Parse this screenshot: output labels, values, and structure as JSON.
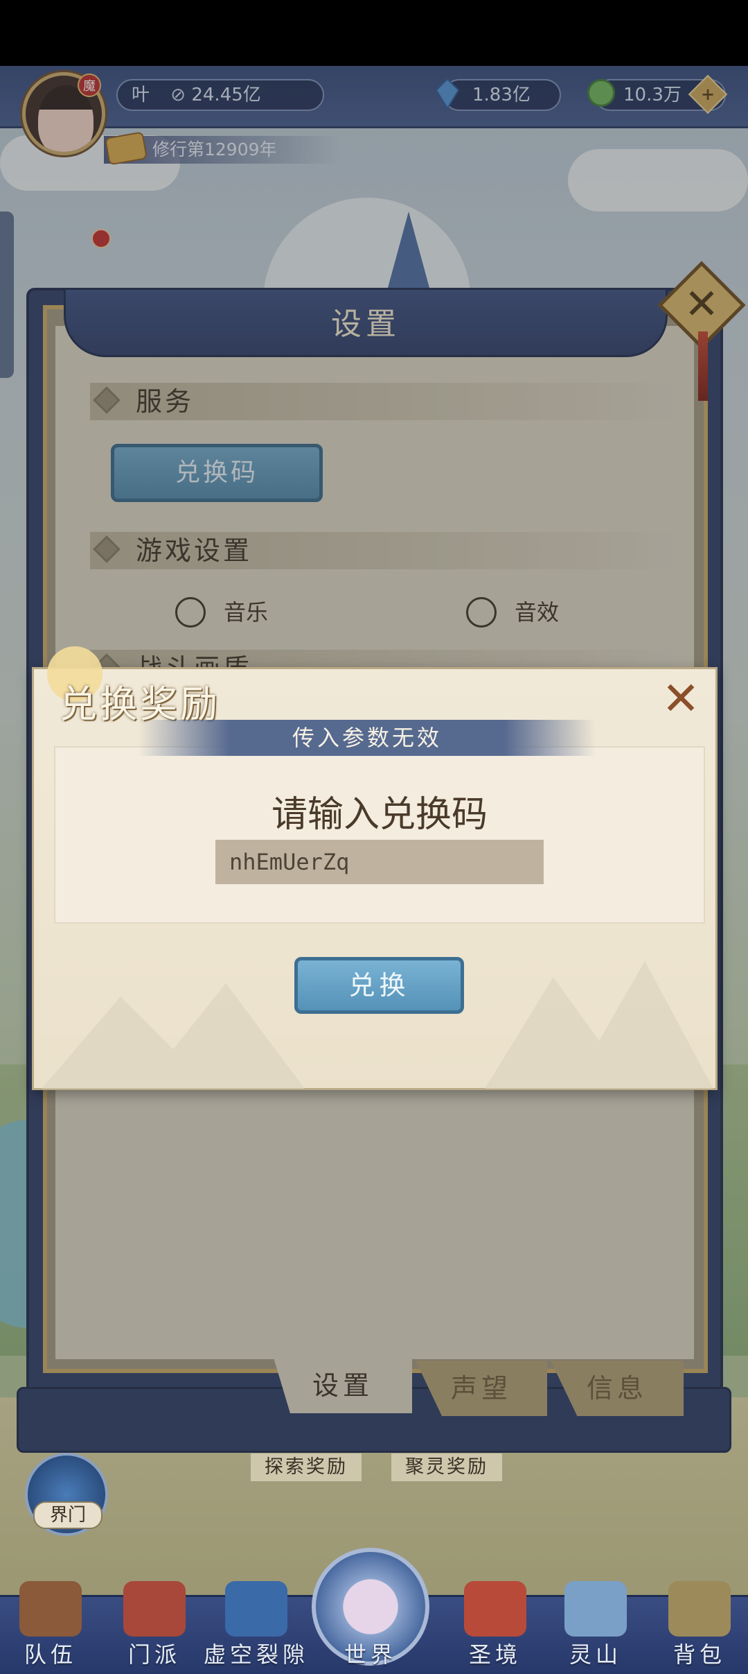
{
  "hud": {
    "name": "叶",
    "power": "24.45亿",
    "gems": "1.83亿",
    "jade": "10.3万",
    "era": "修行第12909年",
    "avatar_badge": "魔"
  },
  "settings_panel": {
    "title": "设置",
    "section_service": "服务",
    "redeem_code_button": "兑换码",
    "section_game": "游戏设置",
    "music_label": "音乐",
    "sfx_label": "音效",
    "section_partial": "战斗画质"
  },
  "panel_tabs": [
    "设置",
    "声望",
    "信息"
  ],
  "dialog": {
    "title": "兑换奖励",
    "error": "传入参数无效",
    "prompt": "请输入兑换码",
    "code_value": "nhEmUerZq",
    "submit_label": "兑换"
  },
  "world": {
    "explore_reward": "探索奖励",
    "gather_reward": "聚灵奖励",
    "gate_label": "界门"
  },
  "nav": [
    "队伍",
    "门派",
    "虚空裂隙",
    "世界",
    "圣境",
    "灵山",
    "背包"
  ],
  "colors": {
    "panel_navy": "#2d3d66",
    "paper": "#d9d3c2",
    "button_blue": "#5592b8",
    "gold": "#c9a864"
  },
  "icons": {
    "power": "eye-slash-icon",
    "gems": "crystal-icon",
    "jade": "jade-coin-icon",
    "add": "plus-icon",
    "close": "close-icon"
  }
}
